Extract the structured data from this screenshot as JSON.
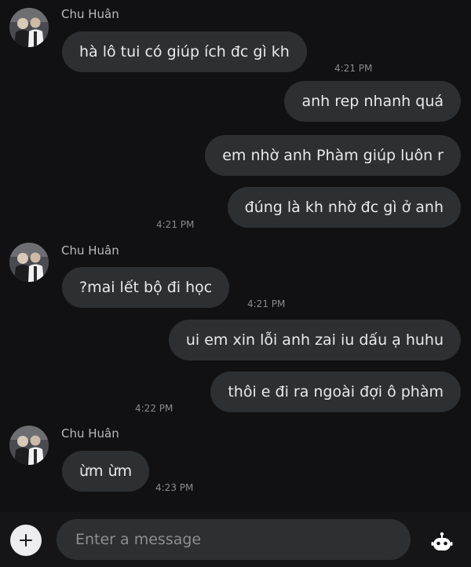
{
  "theme": {
    "background": "#111113",
    "bubble": "#2e2f33",
    "text": "#e9e9ec",
    "timestamp": "#8a8a90"
  },
  "messages": [
    {
      "sender": "Chu Huân",
      "text": "hà lô tui có giúp ích đc gì kh",
      "time": "4:21 PM"
    },
    {
      "text": "anh rep nhanh quá"
    },
    {
      "text": "em nhờ anh Phàm giúp luôn r"
    },
    {
      "text": "đúng là kh nhờ đc gì ở anh",
      "time": "4:21 PM"
    },
    {
      "sender": "Chu Huân",
      "text": "?mai lết bộ đi học",
      "time": "4:21 PM"
    },
    {
      "text": "ui em xin lỗi anh zai iu dấu ạ huhu"
    },
    {
      "text": "thôi e đi ra ngoài đợi ô phàm",
      "time": "4:22 PM"
    },
    {
      "sender": "Chu Huân",
      "text": "ừm ừm",
      "time": "4:23 PM"
    }
  ],
  "composer": {
    "placeholder": "Enter a message",
    "add_icon": "plus-icon",
    "bot_icon": "bot-icon"
  }
}
